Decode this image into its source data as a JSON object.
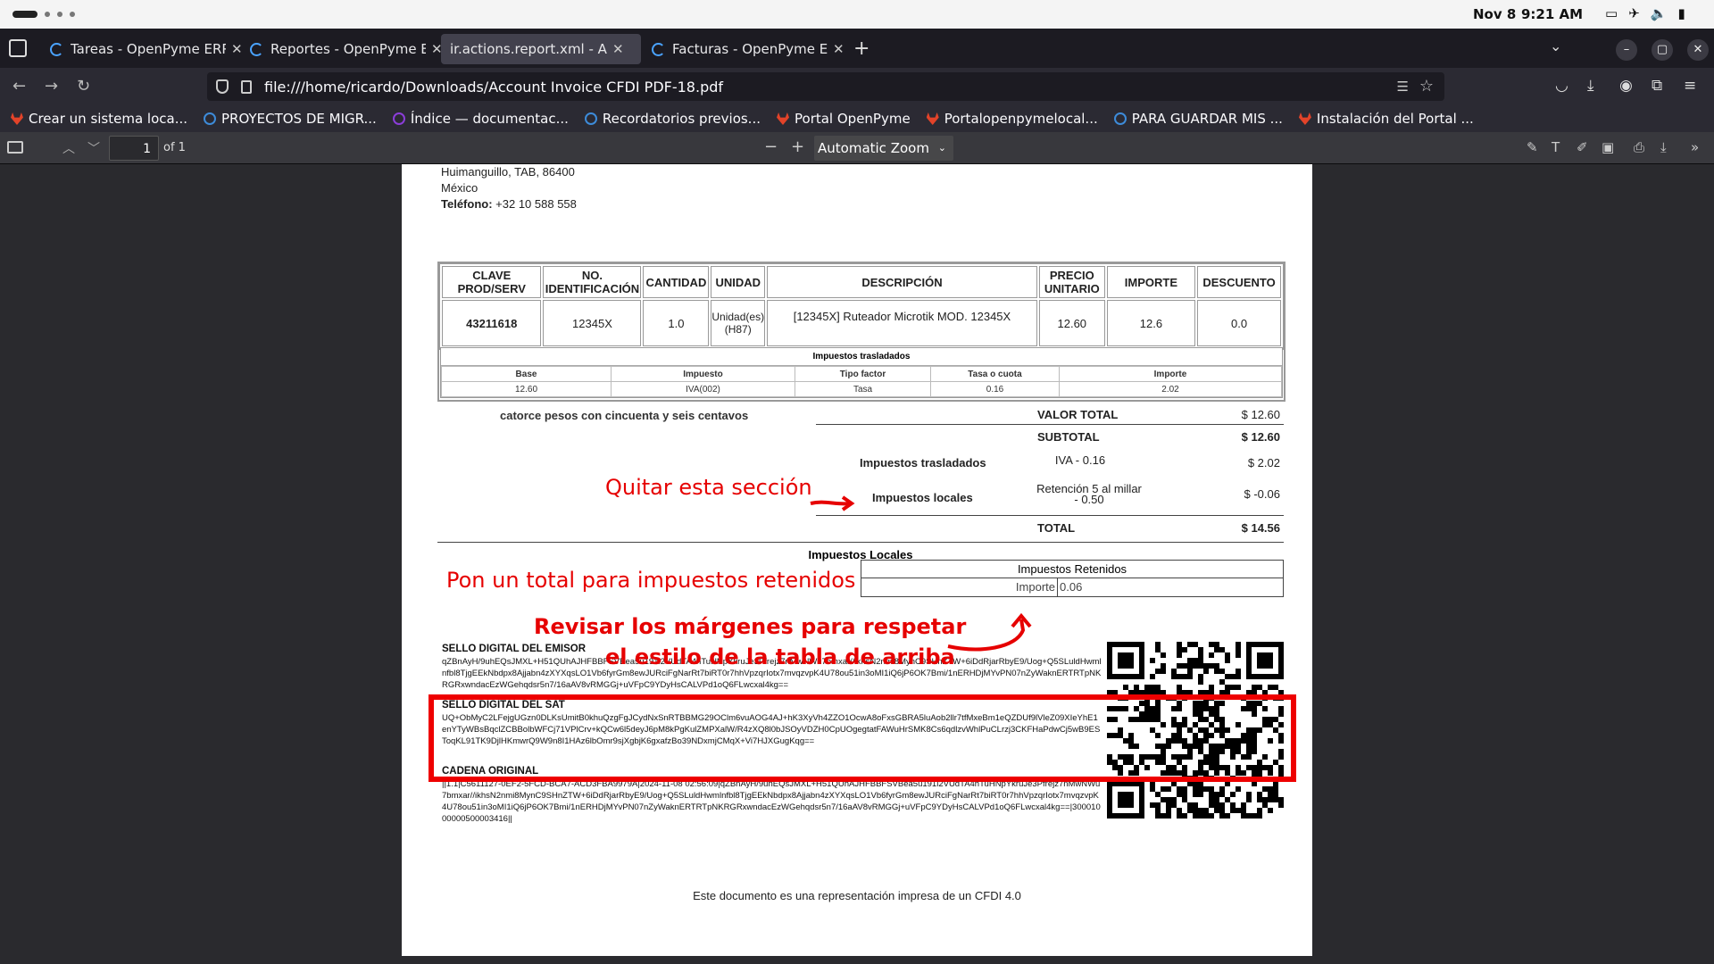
{
  "system_bar": {
    "date": "Nov 8",
    "time": "9:21 AM"
  },
  "tabs": [
    {
      "title": "Tareas - OpenPyme ERP",
      "active": false
    },
    {
      "title": "Reportes - OpenPyme ERP",
      "active": false
    },
    {
      "title": "ir.actions.report.xml - Account",
      "active": true
    },
    {
      "title": "Facturas - OpenPyme ERP",
      "active": false
    }
  ],
  "address_bar": {
    "url": "file:///home/ricardo/Downloads/Account Invoice CFDI PDF-18.pdf"
  },
  "bookmarks": [
    {
      "label": "Crear un sistema loca...",
      "icon": "gitlab-icon"
    },
    {
      "label": "PROYECTOS DE MIGR...",
      "icon": "circle-icon"
    },
    {
      "label": "Índice — documentac...",
      "icon": "circle-purple-icon"
    },
    {
      "label": "Recordatorios previos...",
      "icon": "circle-icon"
    },
    {
      "label": "Portal OpenPyme",
      "icon": "gitlab-icon"
    },
    {
      "label": "Portalopenpymelocal...",
      "icon": "gitlab-icon"
    },
    {
      "label": "PARA GUARDAR MIS ...",
      "icon": "circle-icon"
    },
    {
      "label": "Instalación del Portal ...",
      "icon": "gitlab-icon"
    }
  ],
  "pdf_toolbar": {
    "page": "1",
    "page_count": "of 1",
    "zoom": "Automatic Zoom"
  },
  "document": {
    "address_line1": "Huimanguillo, TAB, 86400",
    "address_line2": "México",
    "phone_label": "Teléfono:",
    "phone": "+32 10 588 558",
    "item_headers": [
      "CLAVE PROD/SERV",
      "NO. IDENTIFICACIÓN",
      "CANTIDAD",
      "UNIDAD",
      "DESCRIPCIÓN",
      "PRECIO UNITARIO",
      "IMPORTE",
      "DESCUENTO"
    ],
    "item_row": [
      "43211618",
      "12345X",
      "1.0",
      "Unidad(es) (H87)",
      "[12345X] Ruteador Microtik MOD. 12345X",
      "12.60",
      "12.6",
      "0.0"
    ],
    "taxes_caption": "Impuestos trasladados",
    "tax_headers": [
      "Base",
      "Impuesto",
      "Tipo factor",
      "Tasa o cuota",
      "Importe"
    ],
    "tax_row": [
      "12.60",
      "IVA(002)",
      "Tasa",
      "0.16",
      "2.02"
    ],
    "amount_words": "catorce pesos con cincuenta y seis centavos",
    "valor_total_label": "VALOR TOTAL",
    "valor_total": "$ 12.60",
    "subtotal_label": "SUBTOTAL",
    "subtotal": "$ 12.60",
    "imp_tras_label": "Impuestos trasladados",
    "imp_tras_desc": "IVA - 0.16",
    "imp_tras_value": "$ 2.02",
    "imp_loc_label": "Impuestos locales",
    "imp_loc_desc1": "Retención 5 al millar",
    "imp_loc_desc2": "- 0.50",
    "imp_loc_value": "$ -0.06",
    "total_label": "TOTAL",
    "total_value": "$ 14.56",
    "local_taxes_title": "Impuestos Locales",
    "retained_title": "Impuestos Retenidos",
    "retained_key": "Importe",
    "retained_value": "0.06",
    "sello_emisor_title": "SELLO DIGITAL DEL EMISOR",
    "sello_emisor": "qZBnAyH/9uhEQsJMXL+H51QUhAJHFBBFSVBea5u191i2VUdTA4hTuHNpYkruJe3Pfrejz7nMwNWu7bmxar//ikhsN2nmi8MynC9SHnZTW+6iDdRjarRbyE9/Uog+Q5SLuldHwmlnfbl8TjgEEkNbdpx8Ajjabn4zXYXqsLO1Vb6fyrGm8ewJURciFgNarRt7biRT0r7hhVpzqrIotx7mvqzvpK4U78ou51in3oMI1iQ6jP6OK7Bmi/1nERHDjMYvPN07nZyWaknERTRTpNKRGRxwndacEzWGehqdsr5n7/16aAV8vRMGGj+uVFpC9YDyHsCALVPd1oQ6FLwcxal4kg==",
    "sello_sat_title": "SELLO DIGITAL DEL SAT",
    "sello_sat": "UQ+ObMyC2LFejgUGzn0DLKsUmitB0khuQzgFgJCydNxSnRTBBMG29OClm6vuAOG4AJ+hK3XyVh4ZZO1OcwA8oFxsGBRA5luAob2llr7tfMxeBm1eQZDUf9lVleZ09XIeYhE1enYTyWBsBqclZCBBolbWFCj71VPlCrv+kQCw6l5deyJ6pM8kPgKulZMPXalW/R4zXQ8l0bJSOyVDZH0CpUOgegtatFAWuHrSMK8Cs6qdlzvWhlPuCLrzj3CKFHaPdwCj5wB9ESToqKL91TK9DjlHKmwrQ9W9n8I1HAz6lbOmr9sjXgbjK6gxafzBo39NDxmjCMqX+Vi7HJXGugKqg==",
    "cadena_title": "CADENA ORIGINAL",
    "cadena": "||1.1|C5611127-0EF2-5FCD-BCA7-ACD3FBA9979A|2024-11-08 02:56:09|qZBnAyH/9uhEQsJMXL+H51QUhAJHFBBFSVBea5u191i2VUdTA4hTuHNpYkruJe3Pfrejz7nMwNWu7bmxar//ikhsN2nmi8MynC9SHnZTW+6iDdRjarRbyE9/Uog+Q5SLuldHwmlnfbl8TjgEEkNbdpx8Ajjabn4zXYXqsLO1Vb6fyrGm8ewJURciFgNarRt7biRT0r7hhVpzqrIotx7mvqzvpK4U78ou51in3oMI1iQ6jP6OK7Bmi/1nERHDjMYvPN07nZyWaknERTRTpNKRGRxwndacEzWGehqdsr5n7/16aAV8vRMGGj+uVFpC9YDyHsCALVPd1oQ6FLwcxal4kg==|30001000000500003416||",
    "footer": "Este documento es una representación impresa de un CFDI 4.0"
  },
  "annotations": {
    "remove_section": "Quitar esta sección",
    "retained_total": "Pon un total para impuestos retenidos",
    "margins_line1": "Revisar los márgenes para respetar",
    "margins_line2": "el estilo de la tabla de arriba",
    "color": "#e60000"
  }
}
